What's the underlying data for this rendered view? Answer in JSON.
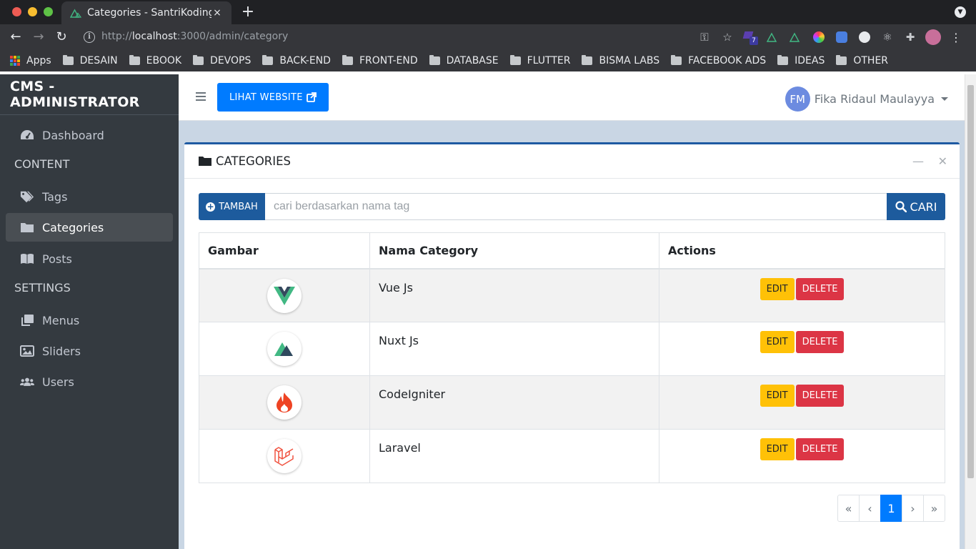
{
  "browser": {
    "tab_title": "Categories - SantriKoding",
    "tab_close": "×",
    "new_tab": "+",
    "url_prefix": "http://",
    "url_host": "localhost",
    "url_path": ":3000/admin/category",
    "bookmarks": [
      "Apps",
      "DESAIN",
      "EBOOK",
      "DEVOPS",
      "BACK-END",
      "FRONT-END",
      "DATABASE",
      "FLUTTER",
      "BISMA LABS",
      "FACEBOOK ADS",
      "IDEAS",
      "OTHER"
    ],
    "extension_badge": "7"
  },
  "sidebar": {
    "brand": "CMS - ADMINISTRATOR",
    "items": [
      {
        "label": "Dashboard",
        "icon": "tachometer-icon"
      },
      {
        "label": "Tags",
        "icon": "tags-icon"
      },
      {
        "label": "Categories",
        "icon": "folder-icon"
      },
      {
        "label": "Posts",
        "icon": "book-icon"
      },
      {
        "label": "Menus",
        "icon": "clone-icon"
      },
      {
        "label": "Sliders",
        "icon": "image-icon"
      },
      {
        "label": "Users",
        "icon": "users-icon"
      }
    ],
    "headers": {
      "content": "CONTENT",
      "settings": "SETTINGS"
    }
  },
  "topnav": {
    "website_button": "LIHAT WEBSITE",
    "user_initials": "FM",
    "user_name": "Fika Ridaul Maulayya"
  },
  "card": {
    "title": "CATEGORIES",
    "add_button": "TAMBAH",
    "search_placeholder": "cari berdasarkan nama tag",
    "search_button": "CARI"
  },
  "table": {
    "headers": [
      "Gambar",
      "Nama Category",
      "Actions"
    ],
    "rows": [
      {
        "name": "Vue Js",
        "logo": "vue-logo"
      },
      {
        "name": "Nuxt Js",
        "logo": "nuxt-logo"
      },
      {
        "name": "CodeIgniter",
        "logo": "codeigniter-logo"
      },
      {
        "name": "Laravel",
        "logo": "laravel-logo"
      }
    ],
    "edit_label": "EDIT",
    "delete_label": "DELETE"
  },
  "pagination": {
    "first": "«",
    "prev": "‹",
    "current": "1",
    "next": "›",
    "last": "»"
  },
  "colors": {
    "primary": "#007bff",
    "sidebar": "#343a40",
    "card_accent": "#1e5aa2",
    "edit": "#ffc107",
    "delete": "#dc3545"
  }
}
